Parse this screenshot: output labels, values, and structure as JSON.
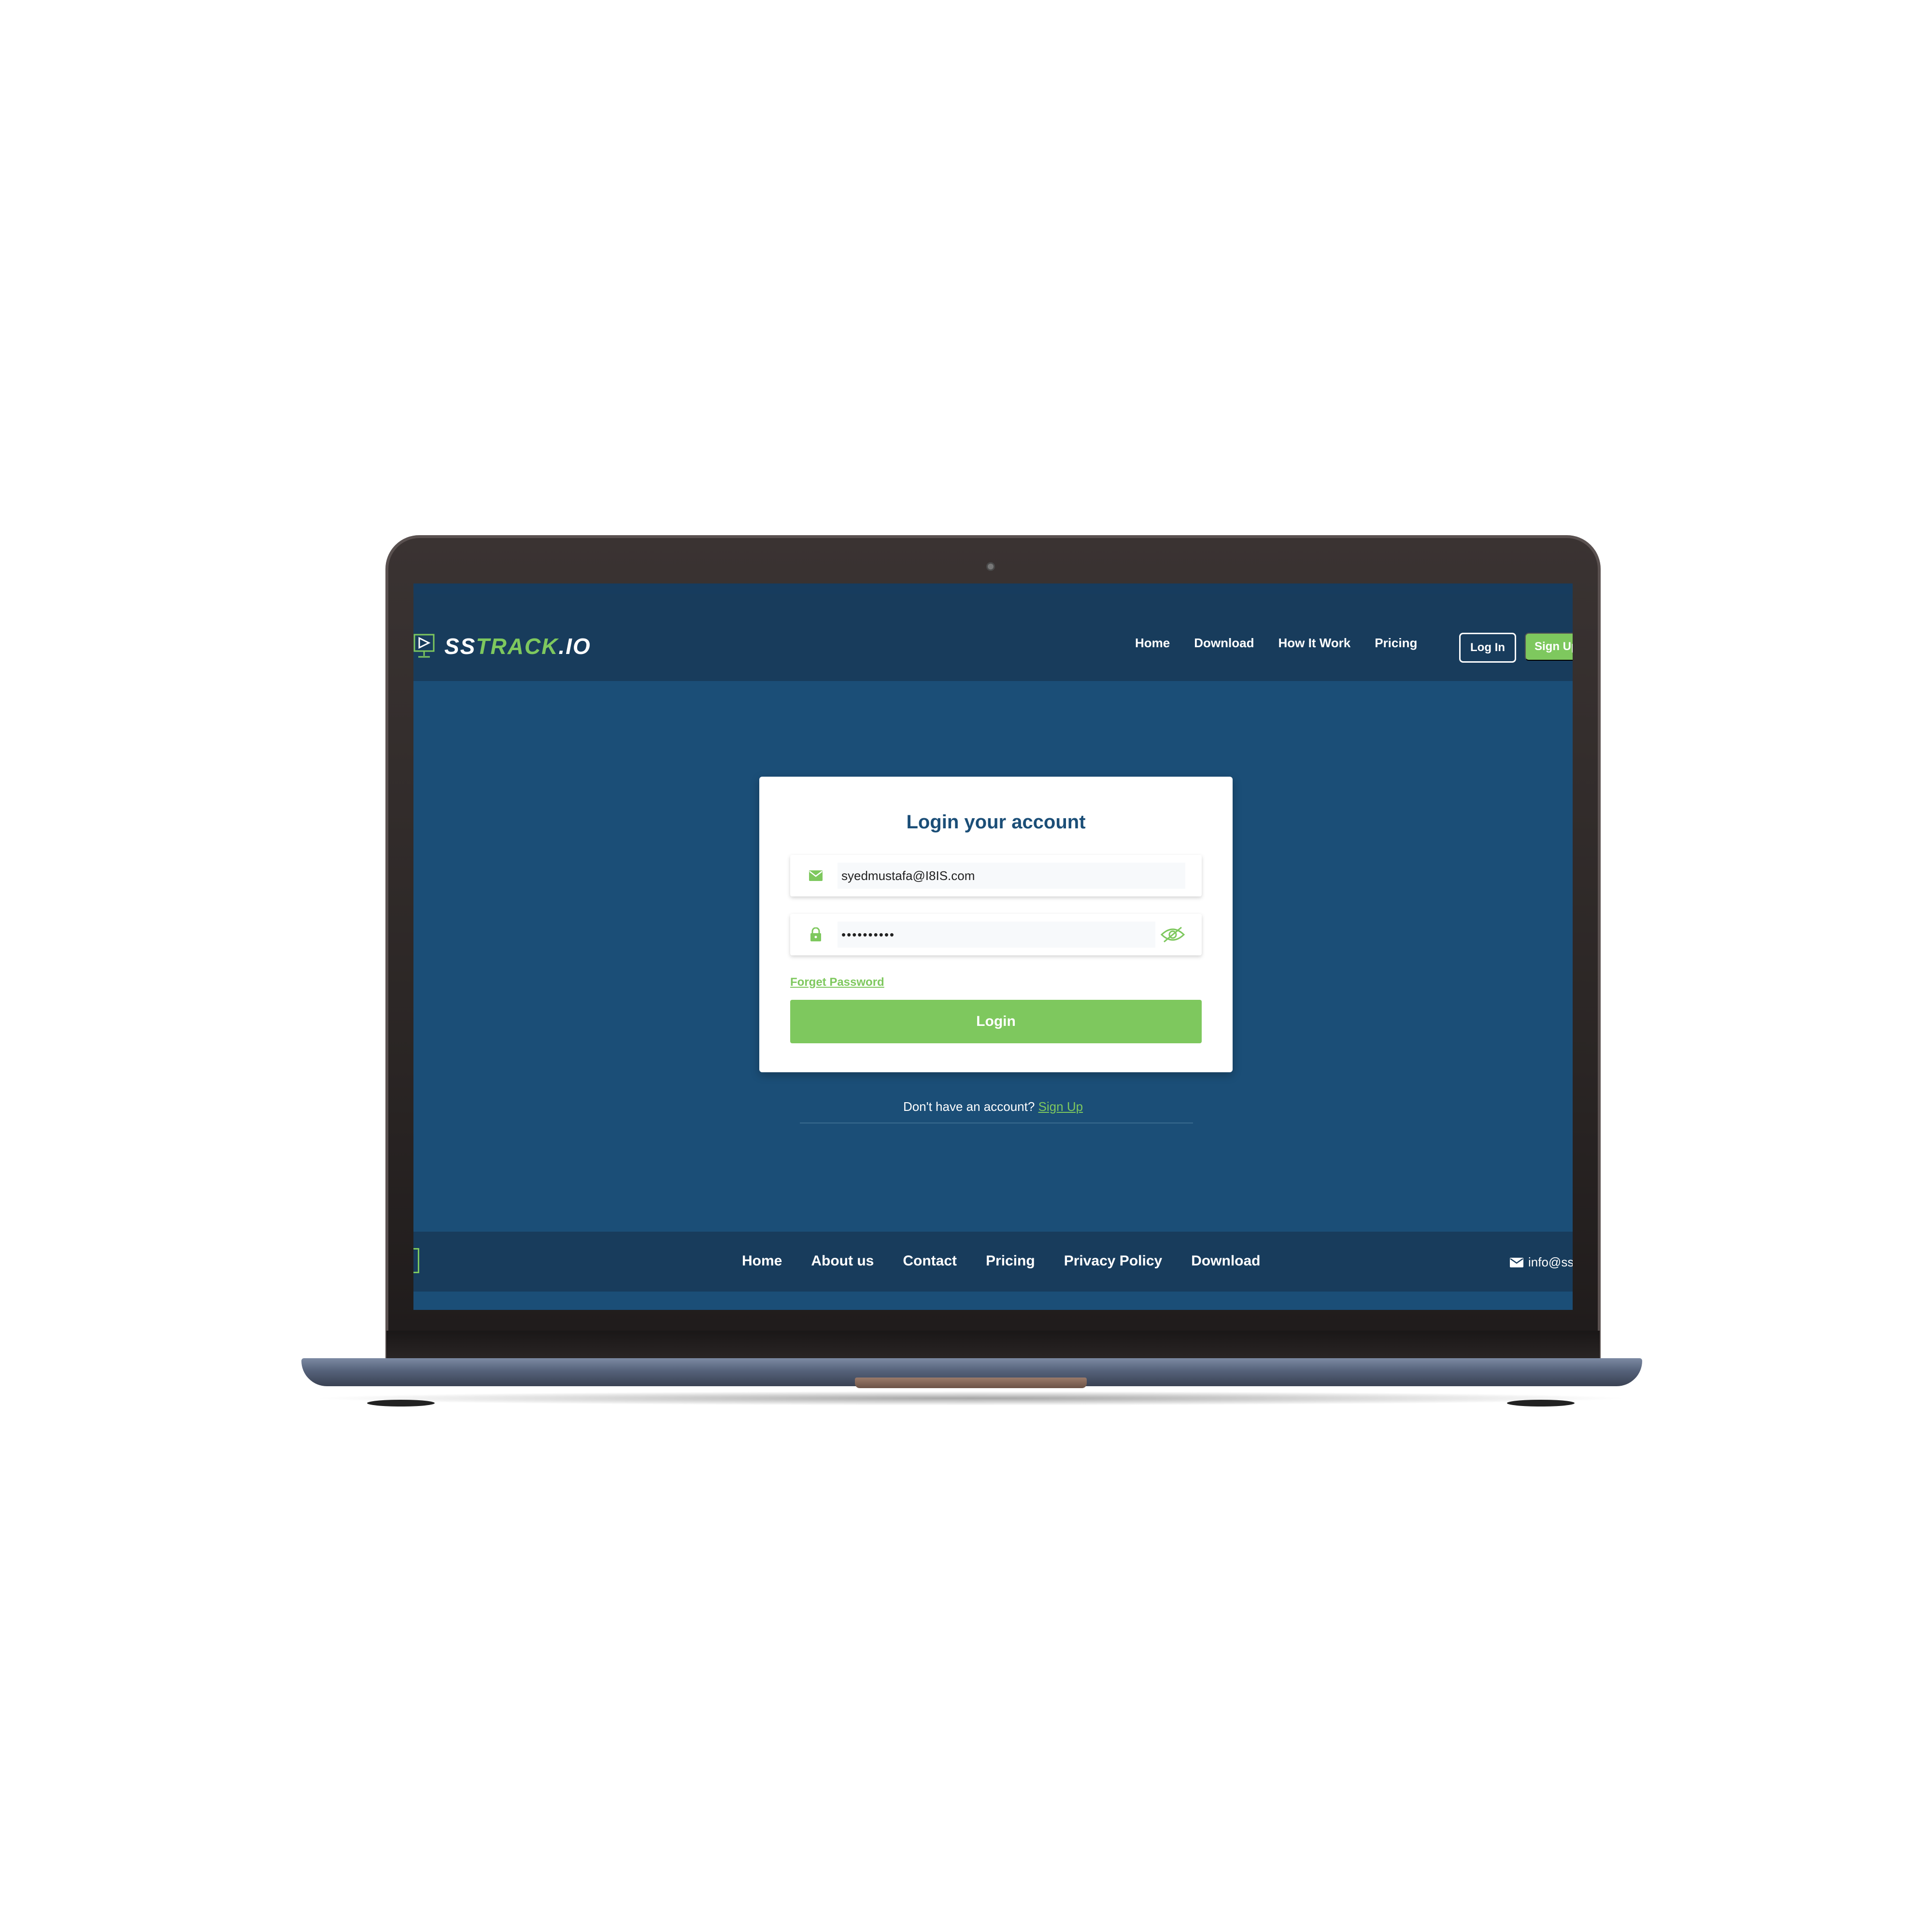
{
  "colors": {
    "brand_green": "#7ec85e",
    "navbar_bg": "#183c5c",
    "page_bg": "#1b4e77",
    "card_bg": "#ffffff",
    "title_color": "#1b4e77"
  },
  "header": {
    "logo": {
      "part1": "SS",
      "part2": "TRACK",
      "part3": ".IO",
      "icon": "monitor-play-icon"
    },
    "nav": [
      "Home",
      "Download",
      "How It Work",
      "Pricing"
    ],
    "login_label": "Log In",
    "signup_label": "Sign Up"
  },
  "login_form": {
    "title": "Login your account",
    "email": {
      "value": "syedmustafa@I8IS.com",
      "icon": "mail-icon"
    },
    "password": {
      "value": "••••••••••",
      "icon": "lock-icon",
      "toggle_icon": "eye-slash-icon"
    },
    "forgot_label": "Forget Password",
    "submit_label": "Login",
    "no_account_text": "Don't have an account?",
    "signup_link": "Sign Up"
  },
  "footer": {
    "links": [
      "Home",
      "About us",
      "Contact",
      "Pricing",
      "Privacy Policy",
      "Download"
    ],
    "email": "info@sst",
    "email_icon": "mail-icon"
  }
}
